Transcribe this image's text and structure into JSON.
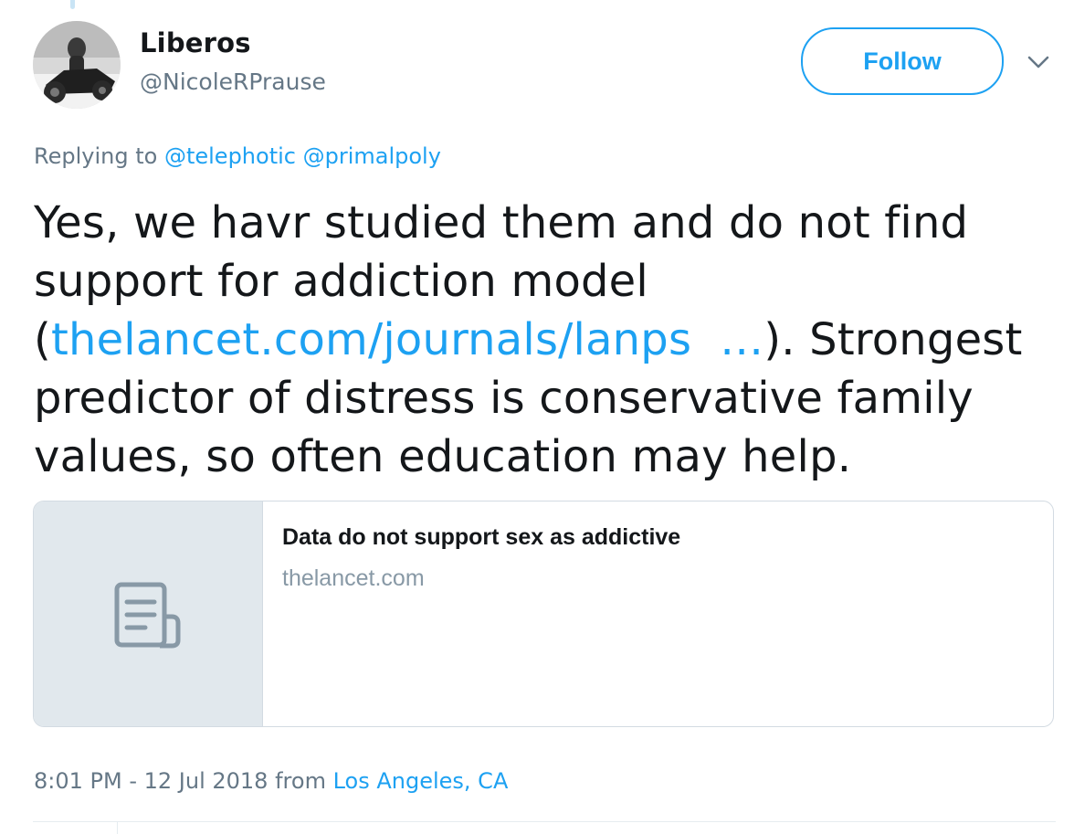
{
  "user": {
    "display_name": "Liberos",
    "handle": "@NicoleRPrause"
  },
  "follow_button": {
    "label": "Follow"
  },
  "more_menu": {
    "icon": "chevron-down-icon"
  },
  "reply_context": {
    "prefix": "Replying to",
    "mentions": [
      "@telephotic",
      "@primalpoly"
    ]
  },
  "tweet": {
    "text_before_link": "Yes, we havr studied them and do not find support for addiction model (",
    "link_text": "thelancet.com/journals/lanps  …",
    "text_after_link": "). Strongest predictor of distress is conservative family values, so often education may help."
  },
  "card": {
    "thumbnail_icon": "document-icon",
    "title": "Data do not support sex as addictive",
    "domain": "thelancet.com"
  },
  "metadata": {
    "timestamp": "8:01 PM - 12 Jul 2018",
    "from_label": "from",
    "location": "Los Angeles, CA"
  },
  "colors": {
    "accent": "#1da1f2",
    "text": "#14171a",
    "secondary_text": "#657786",
    "card_thumb_bg": "#e1e8ed"
  }
}
